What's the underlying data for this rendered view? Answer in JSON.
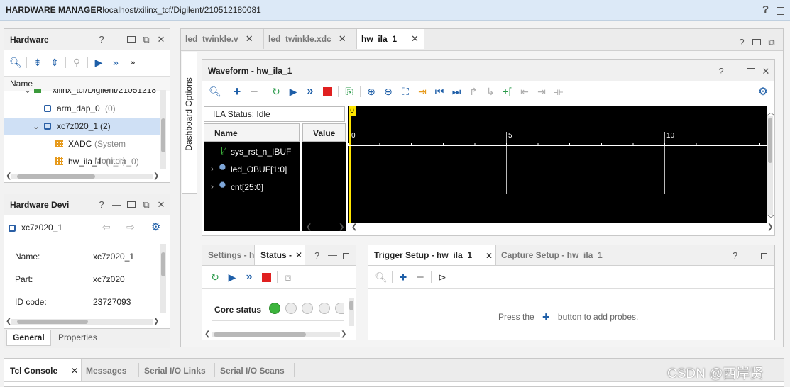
{
  "window": {
    "title": "HARDWARE MANAGER",
    "path": "localhost/xilinx_tcf/Digilent/210512180081",
    "help": "?"
  },
  "hardware": {
    "title": "Hardware",
    "name_header": "Name",
    "tree": [
      {
        "label": "xilinx_tcf/Digilent/21051218",
        "note": ""
      },
      {
        "label": "arm_dap_0",
        "note": "(0)"
      },
      {
        "label": "xc7z020_1",
        "note": "(2)"
      },
      {
        "label": "XADC",
        "note": "(System Monitor)"
      },
      {
        "label": "hw_ila_1",
        "note": "(u_ila_0)"
      }
    ]
  },
  "device": {
    "title": "Hardware Devi",
    "name": "xc7z020_1",
    "props": [
      {
        "key": "Name:",
        "value": "xc7z020_1"
      },
      {
        "key": "Part:",
        "value": "xc7z020"
      },
      {
        "key": "ID code:",
        "value": "23727093"
      }
    ],
    "tabs": [
      "General",
      "Properties"
    ]
  },
  "editor_tabs": [
    {
      "label": "led_twinkle.v"
    },
    {
      "label": "led_twinkle.xdc"
    },
    {
      "label": "hw_ila_1"
    }
  ],
  "dashboard_label": "Dashboard Options",
  "waveform": {
    "title": "Waveform - hw_ila_1",
    "ila_status": "ILA Status:  Idle",
    "name_header": "Name",
    "value_header": "Value",
    "signals": [
      "sys_rst_n_IBUF",
      "led_OBUF[1:0]",
      "cnt[25:0]"
    ],
    "marker_label": "0",
    "ticks": [
      "0",
      "5",
      "10"
    ]
  },
  "status_panel": {
    "tabs": [
      "Settings - h",
      "Status -"
    ],
    "core_status_label": "Core status"
  },
  "trigger_panel": {
    "tabs": [
      "Trigger Setup - hw_ila_1",
      "Capture Setup - hw_ila_1"
    ],
    "hint_before": "Press the",
    "hint_after": "button to add probes."
  },
  "bottom_tabs": [
    "Tcl Console",
    "Messages",
    "Serial I/O Links",
    "Serial I/O Scans"
  ],
  "watermark": "CSDN @西岸贤",
  "colors": {
    "accent": "#1f5fa8",
    "marker": "#ffe600",
    "run_red": "#e02020",
    "status_green": "#3cb43c"
  }
}
